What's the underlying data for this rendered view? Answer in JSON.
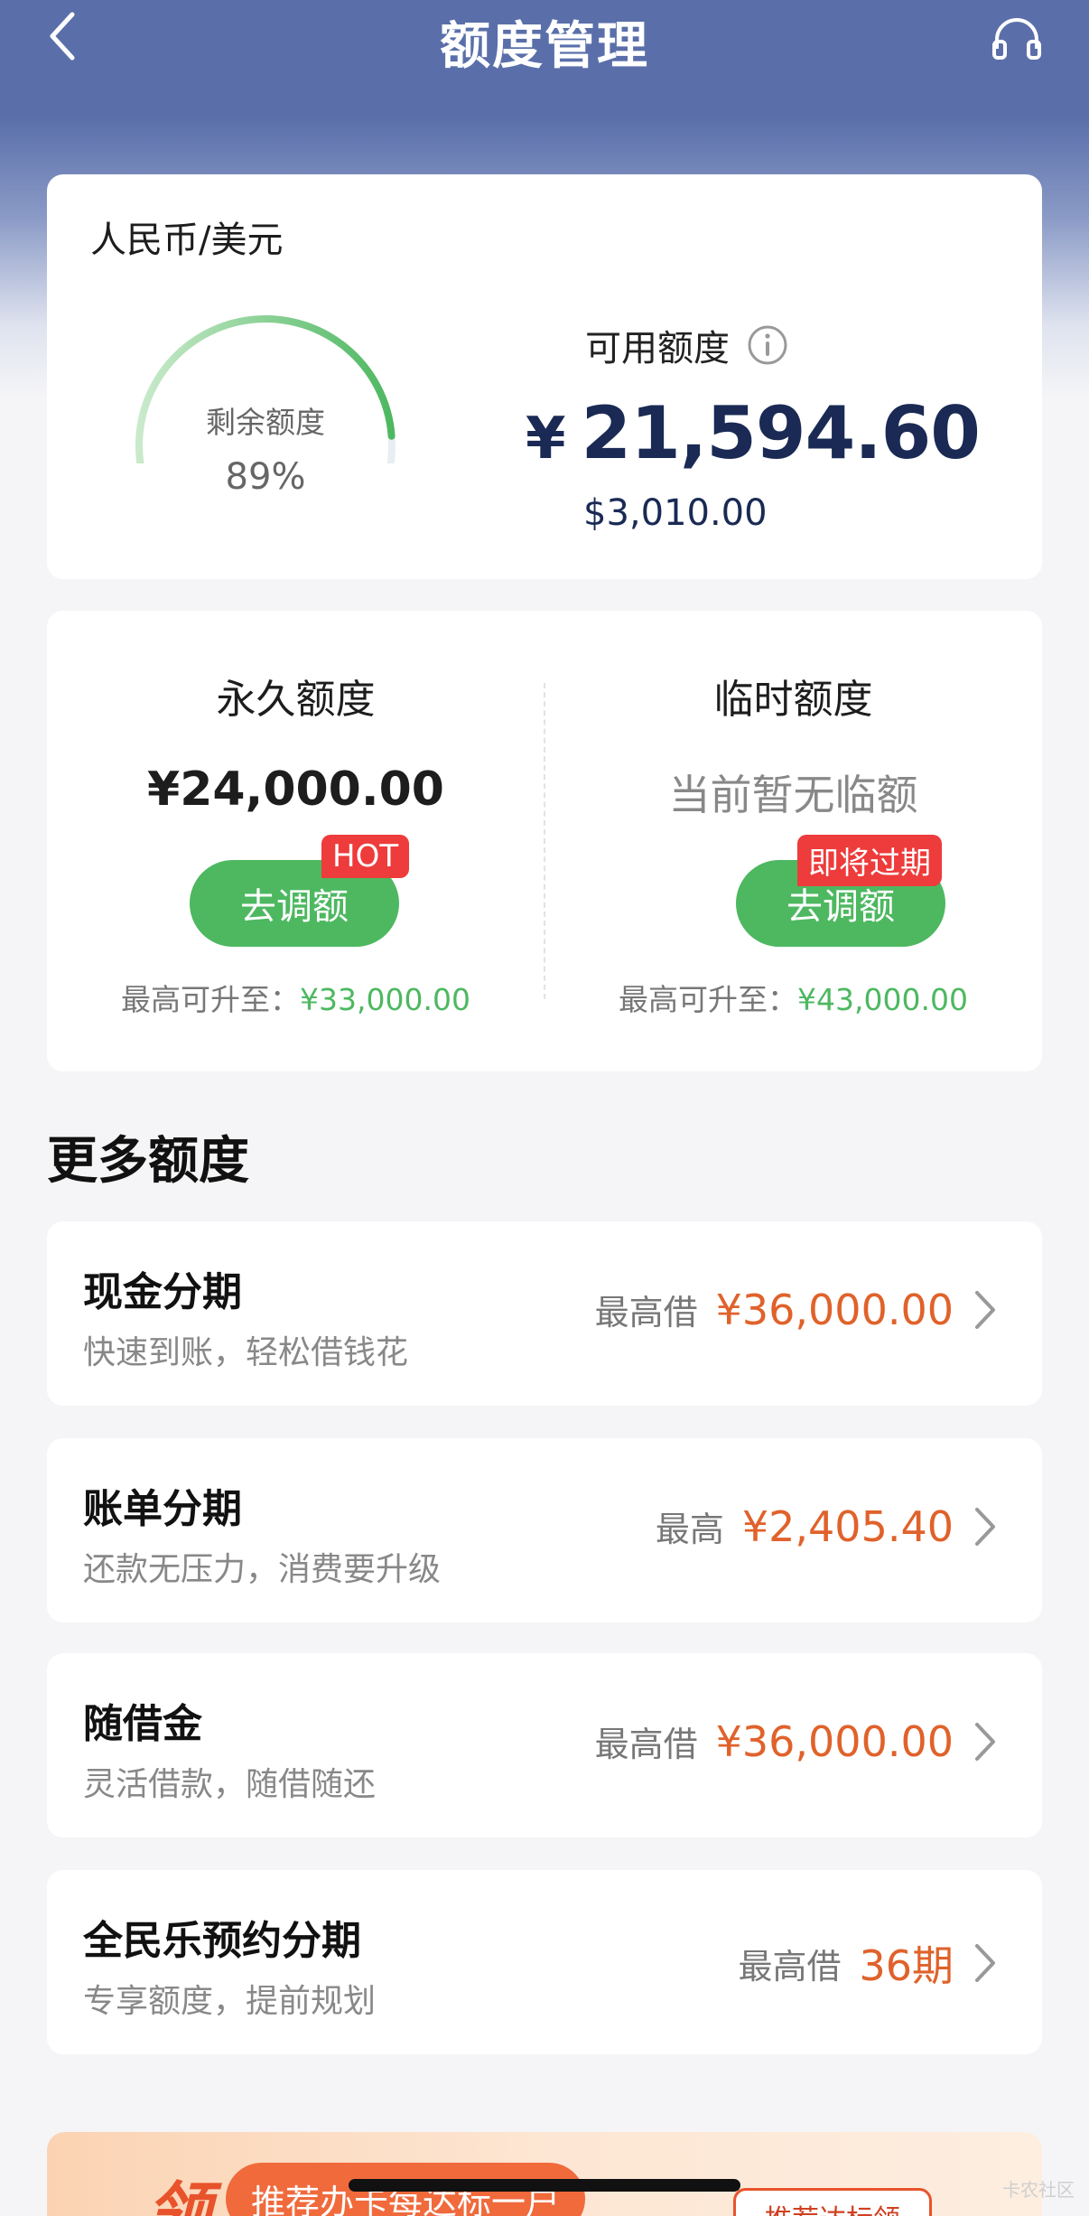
{
  "nav": {
    "title": "额度管理",
    "back_icon": "chevron-left-icon",
    "service_icon": "headset-icon"
  },
  "currency_card": {
    "currency_label": "人民币/美元",
    "remaining_label": "剩余额度",
    "remaining_percent": "89%",
    "remaining_fraction": 0.89,
    "available_label": "可用额度",
    "available_symbol": "¥",
    "available_cny": "21,594.60",
    "available_usd": "$3,010.00"
  },
  "limits": {
    "permanent": {
      "title": "永久额度",
      "amount": "¥24,000.00",
      "button": "去调额",
      "badge": "HOT",
      "max_label": "最高可升至：",
      "max_value": "¥33,000.00"
    },
    "temporary": {
      "title": "临时额度",
      "status": "当前暂无临额",
      "button": "去调额",
      "badge": "即将过期",
      "max_label": "最高可升至：",
      "max_value": "¥43,000.00"
    }
  },
  "more": {
    "title": "更多额度",
    "items": [
      {
        "title": "现金分期",
        "subtitle": "快速到账，轻松借钱花",
        "prefix": "最高借",
        "value": "¥36,000.00"
      },
      {
        "title": "账单分期",
        "subtitle": "还款无压力，消费要升级",
        "prefix": "最高",
        "value": "¥2,405.40"
      },
      {
        "title": "随借金",
        "subtitle": "灵活借款，随借随还",
        "prefix": "最高借",
        "value": "¥36,000.00"
      },
      {
        "title": "全民乐预约分期",
        "subtitle": "专享额度，提前规划",
        "prefix": "最高借",
        "value": "36期"
      }
    ]
  },
  "banner": {
    "ling": "领",
    "pill_text": "推荐办卡每达标一户",
    "button_text": "推荐达标领"
  },
  "watermark": "卡农社区",
  "colors": {
    "header": "#5a6faa",
    "accent_green": "#4db860",
    "accent_orange": "#e0622b",
    "badge_red": "#ee3b3b",
    "amount_navy": "#1a2a55"
  }
}
